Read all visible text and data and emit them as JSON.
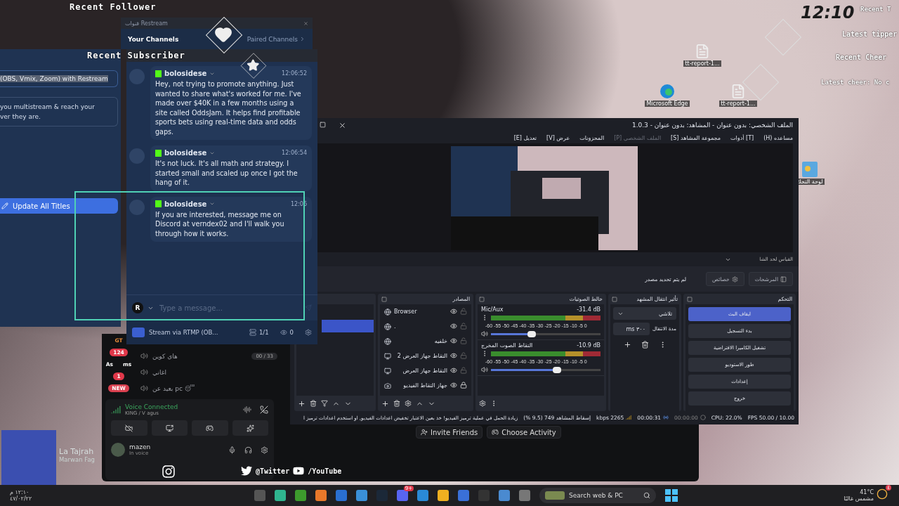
{
  "overlay": {
    "recent_follower": "Recent Follower",
    "recent_subscriber": "Recent Subscriber",
    "clock": "12:10",
    "recent_tip": "Recent T",
    "latest_tipper": "Latest tipper",
    "recent_cheer": "Recent Cheer",
    "latest_cheer": "Latest cheer: No c"
  },
  "desktop_icons": {
    "top_file": {
      "kind": "file",
      "label": "tt-report-1..."
    },
    "browser": {
      "kind": "browser",
      "label": "Microsoft Edge"
    },
    "second_file": {
      "kind": "file",
      "label": "tt-report-1..."
    },
    "control_panel": {
      "kind": "control",
      "label": "لوحة التحك"
    }
  },
  "restream_panel": {
    "title_input": "(OBS, Vmix, Zoom) with Restream",
    "description": [
      "you multistream & reach your",
      "ver they are."
    ],
    "update_button": "Update All Titles"
  },
  "channels_window": {
    "title": "قنوات Restream",
    "your_channels": "Your Channels",
    "paired_channels": "Paired Channels"
  },
  "chat": {
    "messages": [
      {
        "user": "bolosidese",
        "time": "12:06:52",
        "text": "Hey, not trying to promote anything. Just wanted to share what's worked for me. I've made over $40K in a few months using a site called OddsJam. It helps find profitable sports bets using real-time data and odds gaps."
      },
      {
        "user": "bolosidese",
        "time": "12:06:54",
        "text": "It's not luck. It's all math and strategy. I started small and scaled up once I got the hang of it."
      },
      {
        "user": "bolosidese",
        "time": "12:06",
        "text": "If you are interested, message me on Discord at verndex02 and I'll walk you through how it works."
      }
    ],
    "sender_initial": "R",
    "placeholder": "Type a message...",
    "stream_label": "Stream via RTMP (OB...",
    "destinations": "1/1",
    "viewers": "0"
  },
  "obs": {
    "title": "الملف الشخصي: بدون عنوان - المشاهد: بدون عنوان - 1.0.3",
    "menu": [
      {
        "label": "مساعده (H)",
        "disabled": false
      },
      {
        "label": "[T] أدوات",
        "disabled": false
      },
      {
        "label": "مجموعة المشاهد [S]",
        "disabled": false
      },
      {
        "label": "الملف الشخصي [P]",
        "disabled": true
      },
      {
        "label": "المحزونات",
        "disabled": false
      },
      {
        "label": "عرض [V]",
        "disabled": false
      },
      {
        "label": "تعديل [E]",
        "disabled": false
      }
    ],
    "scale_dropdown": "القياس لحد الشا",
    "no_source": "لم يتم تحديد مصدر",
    "properties_button": "خصائص",
    "filters_button": "المرشحات",
    "sources_title": "المصادر",
    "sources": [
      {
        "kind": "browser",
        "name": "Browser",
        "visible": true,
        "locked": false
      },
      {
        "kind": "browser",
        "name": ".",
        "visible": true,
        "locked": false
      },
      {
        "kind": "browser",
        "name": "خلفيه",
        "visible": true,
        "locked": false
      },
      {
        "kind": "display",
        "name": "التقاط جهاز العرض 2",
        "visible": true,
        "locked": false
      },
      {
        "kind": "display",
        "name": "التقاط جهاز العرض",
        "visible": true,
        "locked": false
      },
      {
        "kind": "camera",
        "name": "جهاز التقاط الفيديو",
        "visible": true,
        "locked": true
      }
    ],
    "mixer_title": "خالط الصوتيات",
    "channels": [
      {
        "name": "Mic/Aux",
        "reading": "-31.4 dB",
        "level": 0.37,
        "scale": "-60 -55 -50 -45 -40 -35 -30 -25 -20 -15 -10 -5 0"
      },
      {
        "name": "التقاط الصوت المخرج",
        "reading": "-10.9 dB",
        "level": 0.6,
        "scale": "-60 -55 -50 -45 -40 -35 -30 -25 -20 -15 -10 -5 0"
      }
    ],
    "transitions_title": "تأثير انتقال المشهد",
    "transition": "تلاشي",
    "duration_label": "مدة الانتقال",
    "duration": "٣٠٠ ms",
    "controls_title": "التحكم",
    "controls": [
      {
        "label": "ايقاف البث",
        "active": true
      },
      {
        "label": "بدء التسجيل",
        "active": false
      },
      {
        "label": "تشغيل الكاميرا الافتراضية",
        "active": false
      },
      {
        "label": "طور الاستوديو",
        "active": false
      },
      {
        "label": "إعدادات",
        "active": false
      },
      {
        "label": "خروج",
        "active": false
      }
    ],
    "status": {
      "warning": "زيادة الحمل في عملية ترميز الفيديو! خذ بعين الاعتبار تخفيض اعدادات الفيديو, او استخدم اعدادات ترميز ا",
      "dropped": "إسقاط المشاهد 749 (9.5 %)",
      "bitrate": "2265 kbps",
      "stream_time": "00:00:31",
      "record_time": "00:00:00",
      "cpu": "CPU: 22.0%",
      "fps": "10.00 / 50.00 FPS"
    }
  },
  "discord": {
    "servers": {
      "label": "GT",
      "mentions": "124",
      "folder_a": "As",
      "folder_b": "ms",
      "unread": "1",
      "new_badge": "NEW"
    },
    "channels": [
      {
        "name": "هاي كوين",
        "badge": "00 / 33"
      },
      {
        "name": "اغاني"
      },
      {
        "name": "بعيد عن pc 😴"
      }
    ],
    "voice_status": "Voice Connected",
    "voice_channel": "KING / V agus",
    "user": "mazen",
    "user_status": "In voice",
    "invite": "Invite Friends",
    "activity": "Choose Activity"
  },
  "now_playing": {
    "title": "La Tajrah",
    "artist": "Marwan Fag"
  },
  "social_bar": {
    "twitter": "@Twitter",
    "youtube": "/YouTube"
  },
  "taskbar": {
    "discord_badge": "9+",
    "search": "Search web & PC",
    "temperature": "41°C",
    "weather": "مشمس غالبًا",
    "weather_badge": "٤",
    "time": "١٢:١٠ م",
    "date": "٤٧/٠٢/٢٢"
  }
}
